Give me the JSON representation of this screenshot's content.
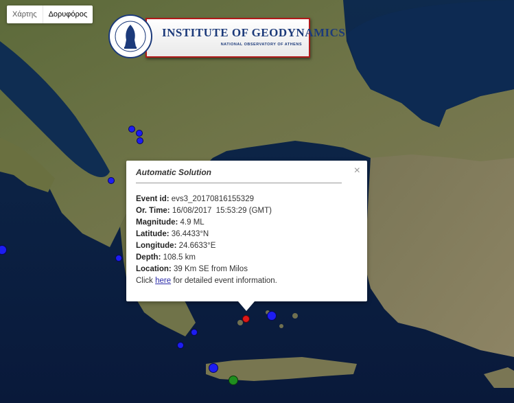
{
  "map_type": {
    "map_label": "Χάρτης",
    "satellite_label": "Δορυφόρος",
    "selected": "Δορυφόρος"
  },
  "logo": {
    "title": "INSTITUTE OF GEODYNAMICS",
    "subtitle": "NATIONAL OBSERVATORY OF ATHENS",
    "seal_text": "INSTITUTE OF GEODYNAMICS · NATIONAL OBSERVATORY OF ATHENS"
  },
  "popup": {
    "title": "Automatic Solution",
    "close_glyph": "×",
    "fields": [
      {
        "label": "Event id:",
        "value": "evs3_20170816155329"
      },
      {
        "label": "Or. Time:",
        "value": "16/08/2017  15:53:29 (GMT)"
      },
      {
        "label": "Magnitude:",
        "value": "4.9 ML"
      },
      {
        "label": "Latitude:",
        "value": "36.4433°N"
      },
      {
        "label": "Longitude:",
        "value": "24.6633°E"
      },
      {
        "label": "Depth:",
        "value": "108.5 km"
      },
      {
        "label": "Location:",
        "value": "39 Km SE from Milos"
      }
    ],
    "click_text": "Click",
    "link_text": "here",
    "link_suffix": "for detailed event information."
  },
  "colors": {
    "blue_marker": "#1d1df2",
    "red_marker": "#e01818",
    "green_marker": "#1f8f1f"
  },
  "icons": {
    "close": "close-icon",
    "seal": "seal-icon"
  }
}
